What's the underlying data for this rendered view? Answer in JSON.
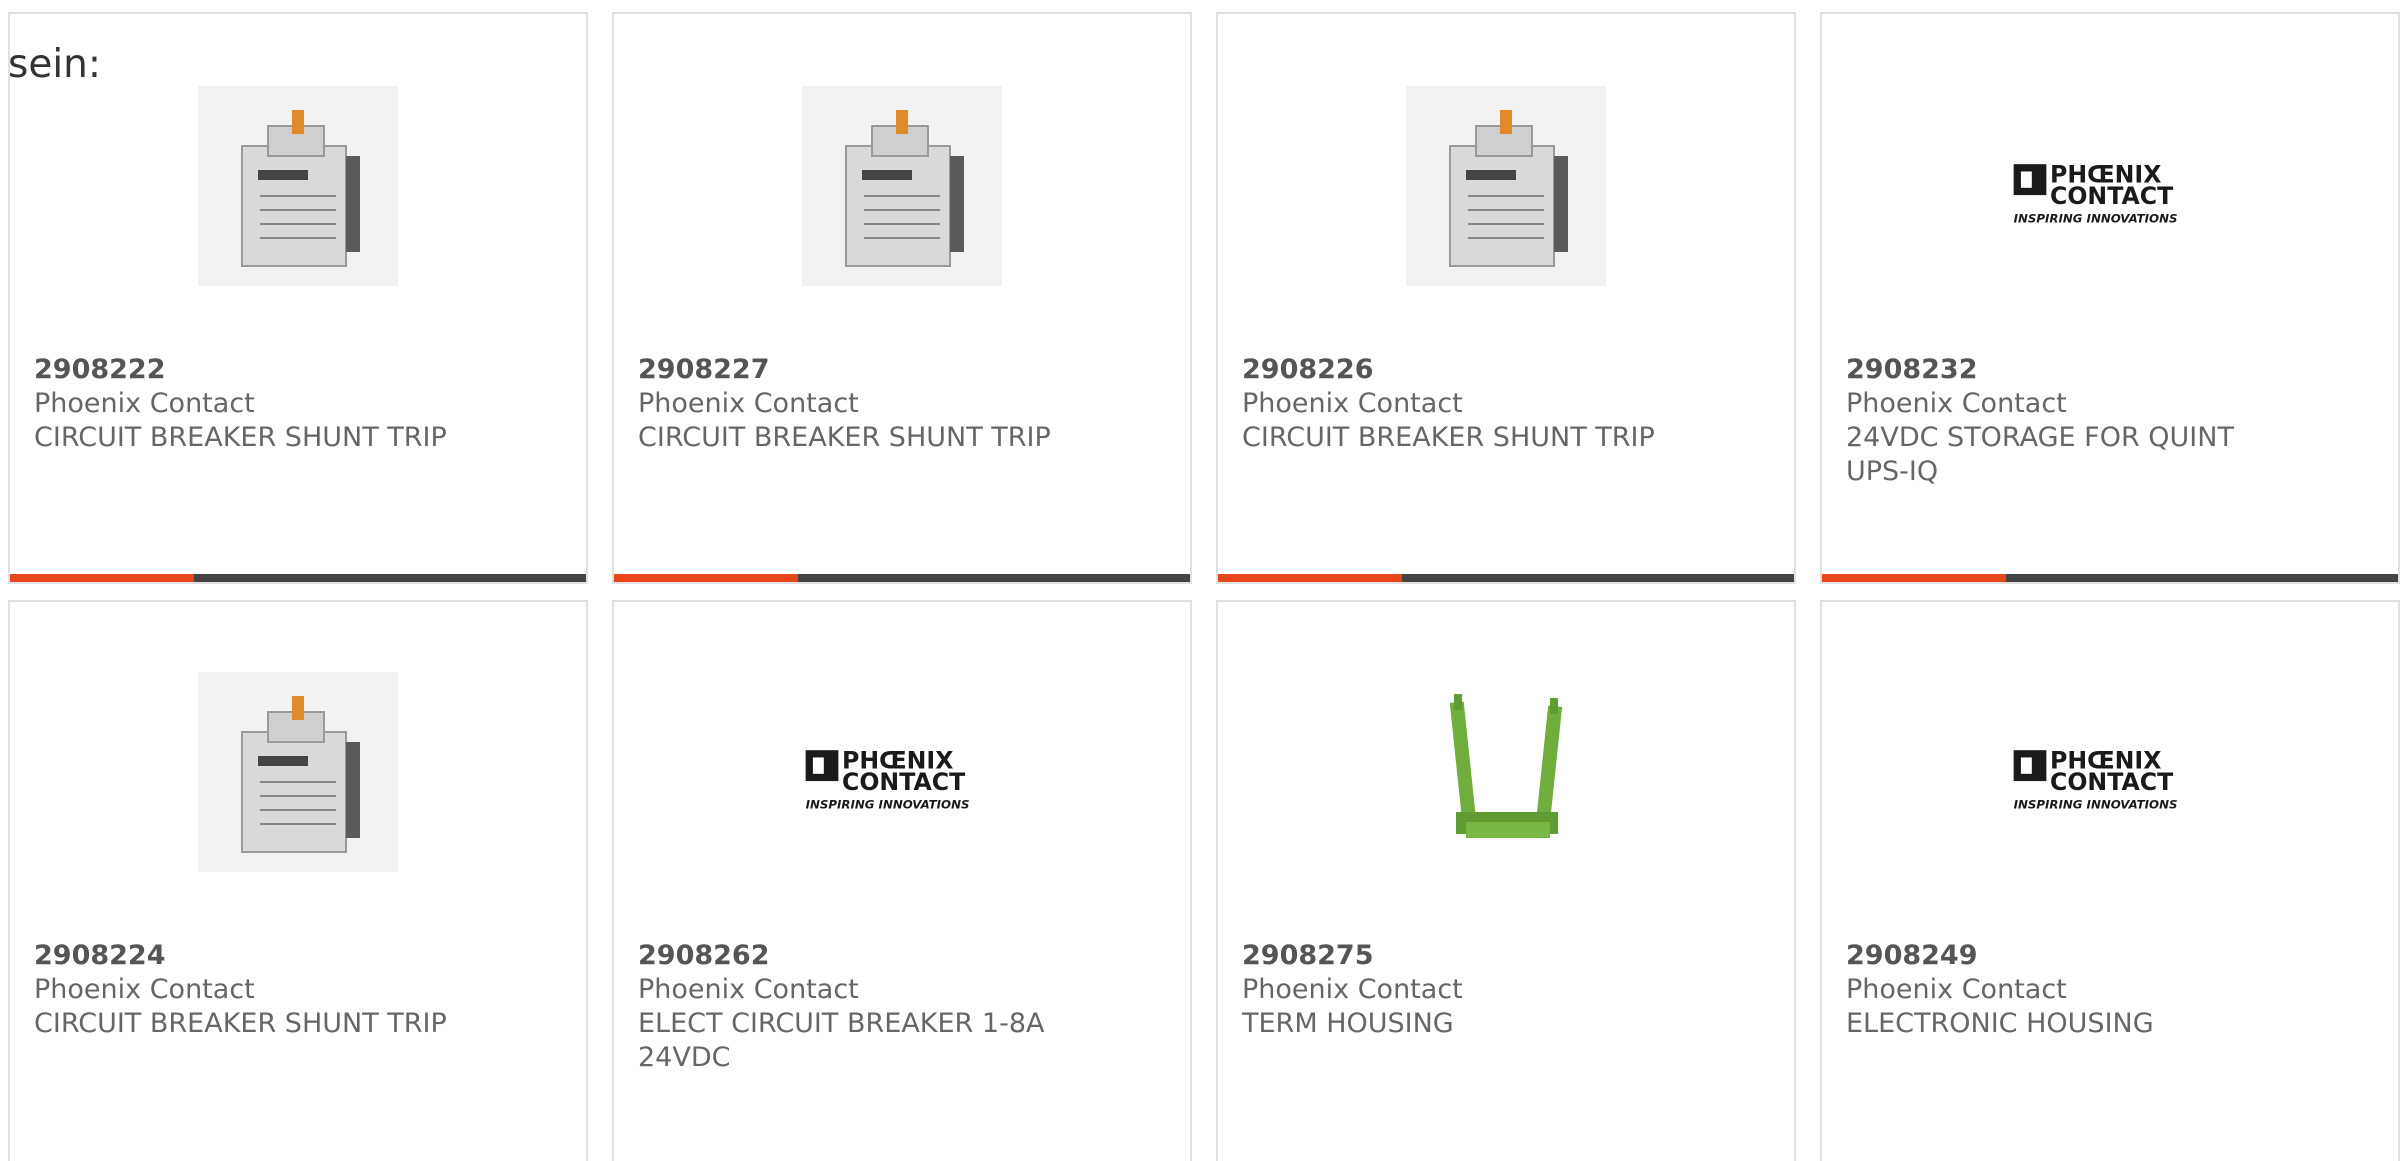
{
  "intro_text": "sein:",
  "products": [
    {
      "part": "2908222",
      "maker": "Phoenix Contact",
      "desc": "CIRCUIT BREAKER SHUNT TRIP",
      "image": "breaker"
    },
    {
      "part": "2908227",
      "maker": "Phoenix Contact",
      "desc": "CIRCUIT BREAKER SHUNT TRIP",
      "image": "breaker"
    },
    {
      "part": "2908226",
      "maker": "Phoenix Contact",
      "desc": "CIRCUIT BREAKER SHUNT TRIP",
      "image": "breaker"
    },
    {
      "part": "2908232",
      "maker": "Phoenix Contact",
      "desc_lines": [
        "24VDC STORAGE FOR QUINT",
        "UPS-IQ"
      ],
      "image": "logo"
    },
    {
      "part": "2908224",
      "maker": "Phoenix Contact",
      "desc": "CIRCUIT BREAKER SHUNT TRIP",
      "image": "breaker"
    },
    {
      "part": "2908262",
      "maker": "Phoenix Contact",
      "desc_lines": [
        "ELECT CIRCUIT BREAKER 1-8A",
        "24VDC"
      ],
      "image": "logo"
    },
    {
      "part": "2908275",
      "maker": "Phoenix Contact",
      "desc": "TERM HOUSING",
      "image": "housing"
    },
    {
      "part": "2908249",
      "maker": "Phoenix Contact",
      "desc": "ELECTRONIC HOUSING",
      "image": "logo"
    }
  ],
  "logo": {
    "line1": "PHŒNIX",
    "line2": "CONTACT",
    "tagline": "INSPIRING INNOVATIONS"
  },
  "colors": {
    "accent": "#e8471b",
    "bar": "#444444",
    "text": "#666666"
  }
}
